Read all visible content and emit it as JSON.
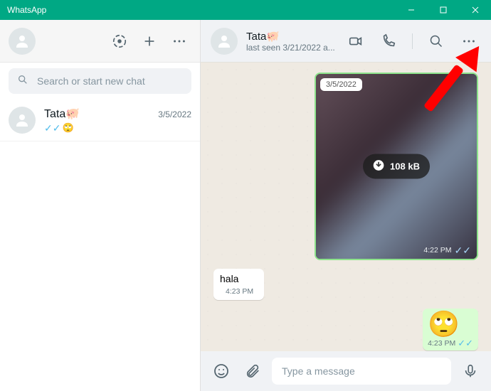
{
  "window": {
    "title": "WhatsApp"
  },
  "search": {
    "placeholder": "Search or start new chat"
  },
  "chats": [
    {
      "name": "Tata🐖",
      "date": "3/5/2022",
      "preview_emoji": "🙄"
    }
  ],
  "conversation": {
    "name": "Tata🐖",
    "lastseen": "last seen 3/21/2022 a...",
    "image_msg": {
      "date_chip": "3/5/2022",
      "size": "108 kB",
      "time": "4:22 PM"
    },
    "text_in": {
      "text": "hala",
      "time": "4:23 PM"
    },
    "emoji_out": {
      "emoji": "🙄",
      "time": "4:23 PM"
    }
  },
  "composer": {
    "placeholder": "Type a message"
  }
}
